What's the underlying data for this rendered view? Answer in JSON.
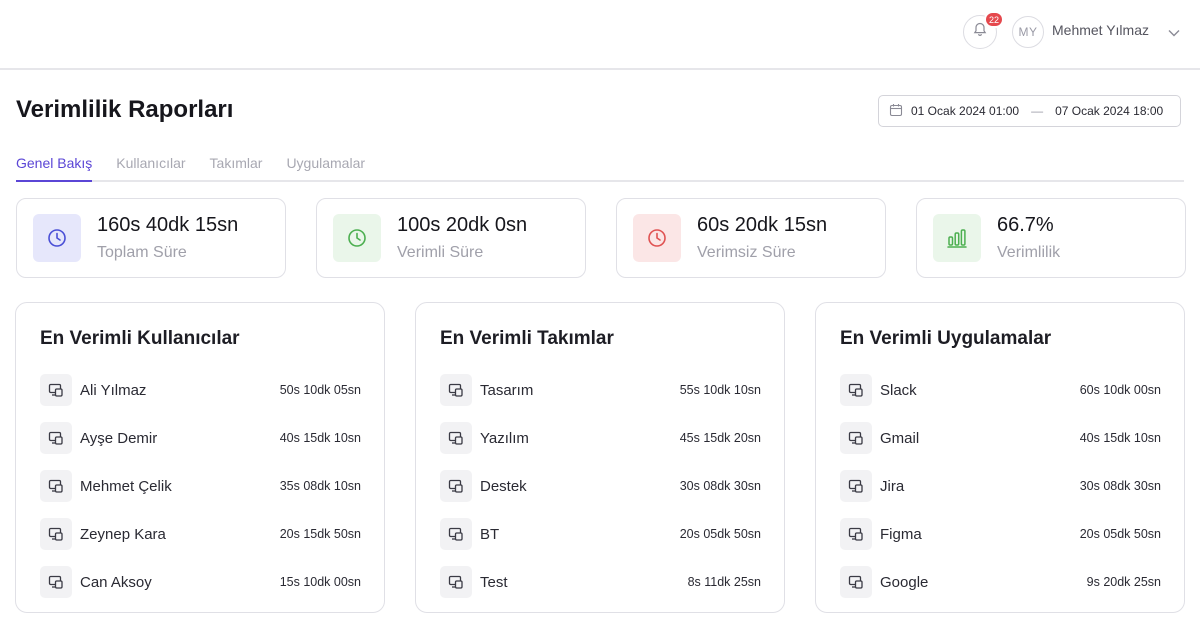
{
  "header": {
    "notification_count": "22",
    "avatar_initials": "MY",
    "user_name": "Mehmet Yılmaz"
  },
  "page": {
    "title": "Verimlilik Raporları",
    "date_start": "01 Ocak 2024 01:00",
    "date_separator": "—",
    "date_end": "07 Ocak 2024 18:00"
  },
  "tabs": [
    {
      "label": "Genel Bakış",
      "active": true
    },
    {
      "label": "Kullanıcılar",
      "active": false
    },
    {
      "label": "Takımlar",
      "active": false
    },
    {
      "label": "Uygulamalar",
      "active": false
    }
  ],
  "stats": [
    {
      "value": "160s 40dk 15sn",
      "label": "Toplam Süre",
      "icon": "clock-icon",
      "color": "#4a4fd6",
      "bg": "#e6e7fb"
    },
    {
      "value": "100s 20dk 0sn",
      "label": "Verimli Süre",
      "icon": "clock-icon",
      "color": "#4caf50",
      "bg": "#eaf6ea"
    },
    {
      "value": "60s 20dk 15sn",
      "label": "Verimsiz Süre",
      "icon": "clock-icon",
      "color": "#e05252",
      "bg": "#fbe6e6"
    },
    {
      "value": "66.7%",
      "label": "Verimlilik",
      "icon": "bar-chart-icon",
      "color": "#4caf50",
      "bg": "#eaf6ea"
    }
  ],
  "lists": [
    {
      "title": "En Verimli Kullanıcılar",
      "rows": [
        {
          "name": "Ali Yılmaz",
          "value": "50s 10dk 05sn"
        },
        {
          "name": "Ayşe Demir",
          "value": "40s 15dk 10sn"
        },
        {
          "name": "Mehmet Çelik",
          "value": "35s 08dk 10sn"
        },
        {
          "name": "Zeynep Kara",
          "value": "20s 15dk 50sn"
        },
        {
          "name": "Can Aksoy",
          "value": "15s 10dk 00sn"
        }
      ]
    },
    {
      "title": "En Verimli Takımlar",
      "rows": [
        {
          "name": "Tasarım",
          "value": "55s 10dk 10sn"
        },
        {
          "name": "Yazılım",
          "value": "45s 15dk 20sn"
        },
        {
          "name": "Destek",
          "value": "30s 08dk 30sn"
        },
        {
          "name": "BT",
          "value": "20s 05dk 50sn"
        },
        {
          "name": "Test",
          "value": "8s 11dk 25sn"
        }
      ]
    },
    {
      "title": "En Verimli Uygulamalar",
      "rows": [
        {
          "name": "Slack",
          "value": "60s 10dk 00sn"
        },
        {
          "name": "Gmail",
          "value": "40s 15dk 10sn"
        },
        {
          "name": "Jira",
          "value": "30s 08dk 30sn"
        },
        {
          "name": "Figma",
          "value": "20s 05dk 50sn"
        },
        {
          "name": "Google",
          "value": "9s 20dk 25sn"
        }
      ]
    }
  ]
}
